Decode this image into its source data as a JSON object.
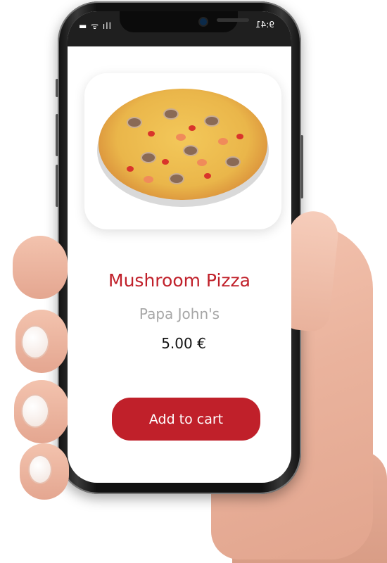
{
  "status_bar": {
    "signal_icons": "▬ ᯤ ıll",
    "time": "9:41"
  },
  "product": {
    "image_alt": "pizza-image",
    "name": "Mushroom Pizza",
    "vendor": "Papa John's",
    "price": "5.00 €"
  },
  "actions": {
    "add_to_cart_label": "Add to cart"
  },
  "colors": {
    "accent": "#c0202a",
    "vendor_text": "#a6a6a6"
  }
}
